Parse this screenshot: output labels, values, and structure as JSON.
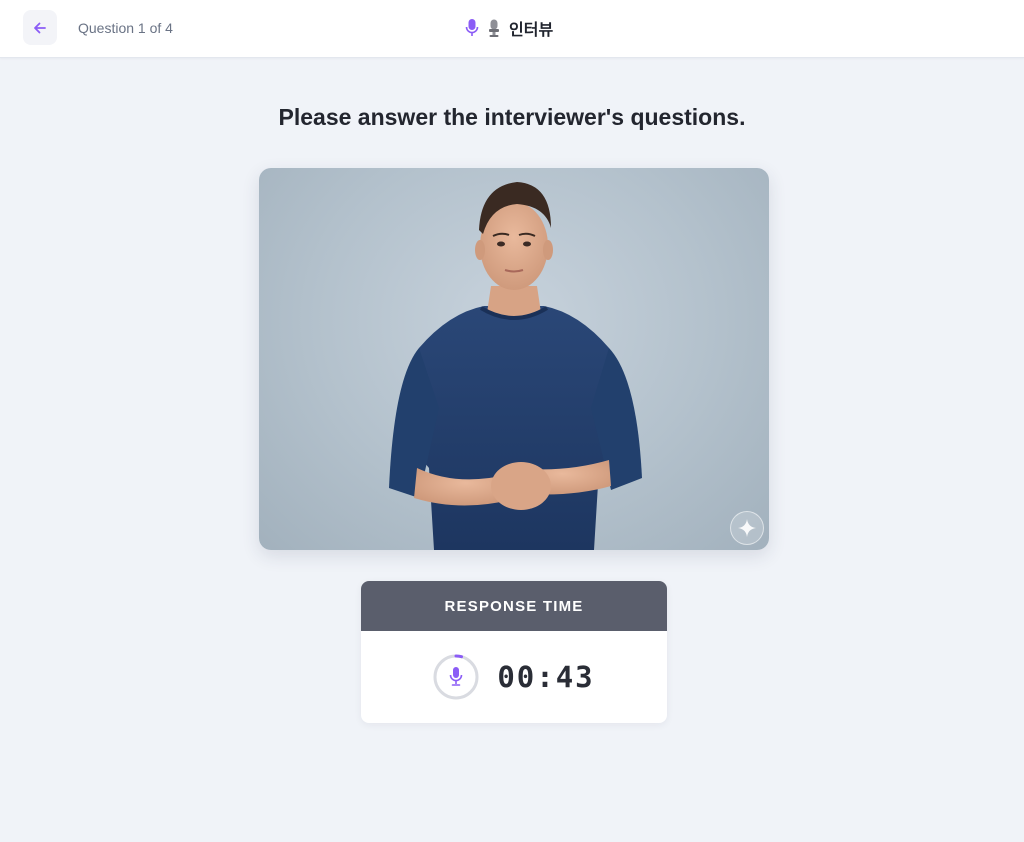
{
  "header": {
    "progress_text": "Question 1 of 4",
    "title": "인터뷰",
    "icons": [
      "back-arrow-icon",
      "microphone-icon",
      "microphone-stand-icon"
    ]
  },
  "main": {
    "instruction": "Please answer the interviewer's questions."
  },
  "timer": {
    "label": "RESPONSE TIME",
    "value": "00:43"
  },
  "colors": {
    "accent": "#8b5cf6",
    "background": "#f0f3f8",
    "timer_header": "#5a5e6c"
  }
}
